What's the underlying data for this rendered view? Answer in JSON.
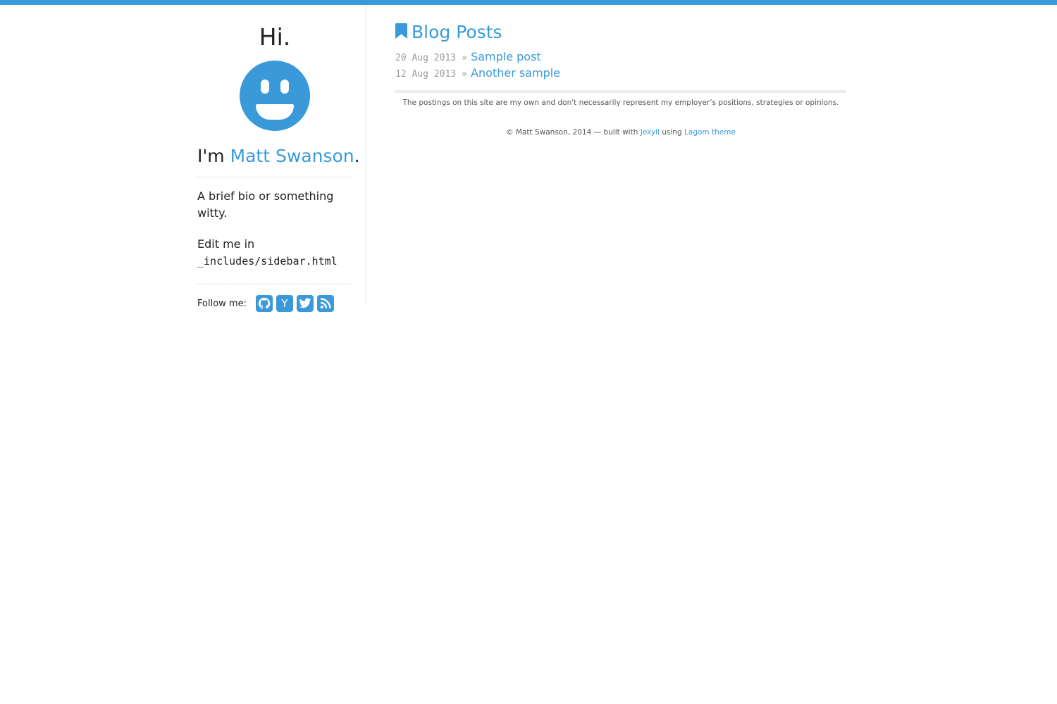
{
  "colors": {
    "accent": "#3a9ad9",
    "text": "#222222",
    "muted": "#9a9a9a"
  },
  "sidebar": {
    "greeting": "Hi.",
    "avatar_icon": "smiley-face-icon",
    "intro_prefix": "I'm ",
    "author_name": "Matt Swanson",
    "intro_suffix": ".",
    "bio": "A brief bio or something witty.",
    "edit_prefix": "Edit me in",
    "edit_path": "_includes/sidebar.html",
    "follow_label": "Follow me:",
    "social": [
      {
        "name": "github-icon"
      },
      {
        "name": "hacker-news-icon",
        "glyph": "Y"
      },
      {
        "name": "twitter-icon"
      },
      {
        "name": "rss-icon"
      }
    ]
  },
  "main": {
    "heading_icon": "bookmark-icon",
    "heading": "Blog Posts",
    "posts": [
      {
        "date": "20 Aug 2013",
        "sep": "»",
        "title": "Sample post"
      },
      {
        "date": "12 Aug 2013",
        "sep": "»",
        "title": "Another sample"
      }
    ],
    "disclaimer": "The postings on this site are my own and don't necessarily represent my employer’s positions, strategies or opinions.",
    "footer": {
      "prefix": "© Matt Swanson, 2014 — built with ",
      "jekyll": "Jekyll",
      "middle": " using ",
      "theme": "Lagom theme"
    }
  }
}
